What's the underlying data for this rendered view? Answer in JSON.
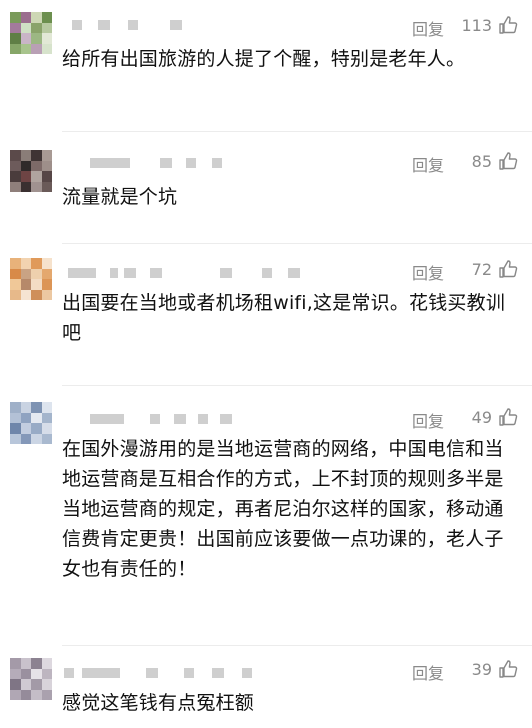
{
  "comments": [
    {
      "reply_label": "回复",
      "likes": "113",
      "text": "给所有出国旅游的人提了个醒，特别是老年人。",
      "avatar_colors": [
        "#7a9a5a",
        "#9b6e8e",
        "#cdd7b4",
        "#6c8f4e",
        "#a37a9c",
        "#cfe0c4",
        "#8aa36a",
        "#b7c9a0",
        "#5f7f45",
        "#c9b5c7",
        "#9cb783",
        "#e2e8d6",
        "#86a668",
        "#a8c48d",
        "#b9a0b5",
        "#d7e3cc"
      ]
    },
    {
      "reply_label": "回复",
      "likes": "85",
      "text": "流量就是个坑",
      "avatar_colors": [
        "#5b4a4a",
        "#8a7d78",
        "#3f3434",
        "#a89a94",
        "#6d5b5b",
        "#2f2a2a",
        "#7d6a68",
        "#9e8f8a",
        "#4a3c3c",
        "#6e4444",
        "#b0a49f",
        "#564646",
        "#8f7f7b",
        "#3a3030",
        "#a09290",
        "#6a5a58"
      ]
    },
    {
      "reply_label": "回复",
      "likes": "72",
      "text": "出国要在当地或者机场租wifi,这是常识。花钱买教训吧",
      "avatar_colors": [
        "#e8b27a",
        "#f2d3b0",
        "#e09a5a",
        "#f6e2cc",
        "#d88a48",
        "#c9a384",
        "#eed0ad",
        "#e4a86e",
        "#f0c898",
        "#b6896a",
        "#f3dcc4",
        "#dc9556",
        "#e7b98a",
        "#f5e4d2",
        "#cf8f5a",
        "#ecc8a2"
      ]
    },
    {
      "reply_label": "回复",
      "likes": "49",
      "text": "在国外漫游用的是当地运营商的网络，中国电信和当地运营商是互相合作的方式，上不封顶的规则多半是当地运营商的规定，再者尼泊尔这样的国家，移动通信费肯定更贵！出国前应该要做一点功课的，老人子女也有责任的！",
      "avatar_colors": [
        "#9fb0c8",
        "#c9d3e2",
        "#7e93b3",
        "#dde4ee",
        "#b3c1d6",
        "#8fa3c1",
        "#e4e9f1",
        "#a4b5cc",
        "#6f86aa",
        "#c2cde0",
        "#98abc6",
        "#d6dde9",
        "#b8c6da",
        "#8498b9",
        "#cbd5e4",
        "#a9b9cf"
      ]
    },
    {
      "reply_label": "回复",
      "likes": "39",
      "text": "感觉这笔钱有点冤枉额",
      "avatar_colors": [
        "#a49aa8",
        "#c9c2cc",
        "#8c8291",
        "#ddd8df",
        "#b5acb9",
        "#9a909f",
        "#e6e2e8",
        "#bdb5c0",
        "#7f7585",
        "#cfc9d2",
        "#a39aa7",
        "#d8d3da",
        "#b0a7b4",
        "#958b9a",
        "#c4bdc7",
        "#aaa1ae"
      ]
    }
  ]
}
